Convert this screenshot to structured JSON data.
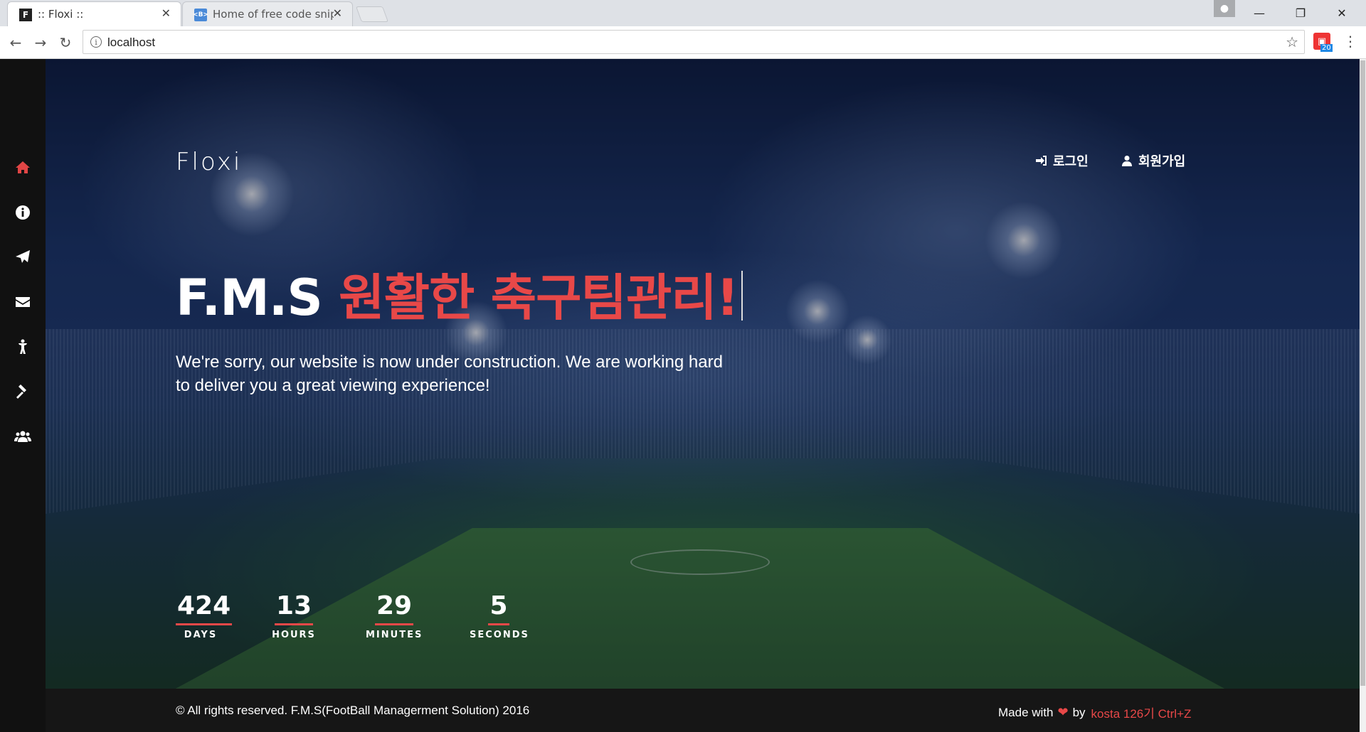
{
  "browser": {
    "tabs": [
      {
        "title": ":: Floxi ::",
        "favicon": "F"
      },
      {
        "title": "Home of free code snip",
        "favicon": "<B>"
      }
    ],
    "url": "localhost",
    "extension_badge": "20"
  },
  "site": {
    "logo": "Floxi",
    "nav": {
      "login": "로그인",
      "signup": "회원가입"
    },
    "side_nav": [
      "home-icon",
      "info-icon",
      "paper-plane-icon",
      "envelope-icon",
      "child-icon",
      "gavel-icon",
      "users-icon"
    ],
    "headline": {
      "brand": "F.M.S",
      "tagline": "원활한 축구팀관리!"
    },
    "subtext": "We're sorry, our website is now under construction. We are working hard to deliver you a great viewing experience!",
    "countdown": [
      {
        "value": "424",
        "label": "DAYS"
      },
      {
        "value": "13",
        "label": "HOURS"
      },
      {
        "value": "29",
        "label": "MINUTES"
      },
      {
        "value": "5",
        "label": "SECONDS"
      }
    ],
    "footer": {
      "copyright": "© All rights reserved. F.M.S(FootBall Managerment Solution) 2016",
      "made_with": "Made with",
      "by": "by",
      "author": "kosta 126기 Ctrl+Z"
    }
  },
  "colors": {
    "accent": "#e84848",
    "footer_bg": "#161616"
  }
}
